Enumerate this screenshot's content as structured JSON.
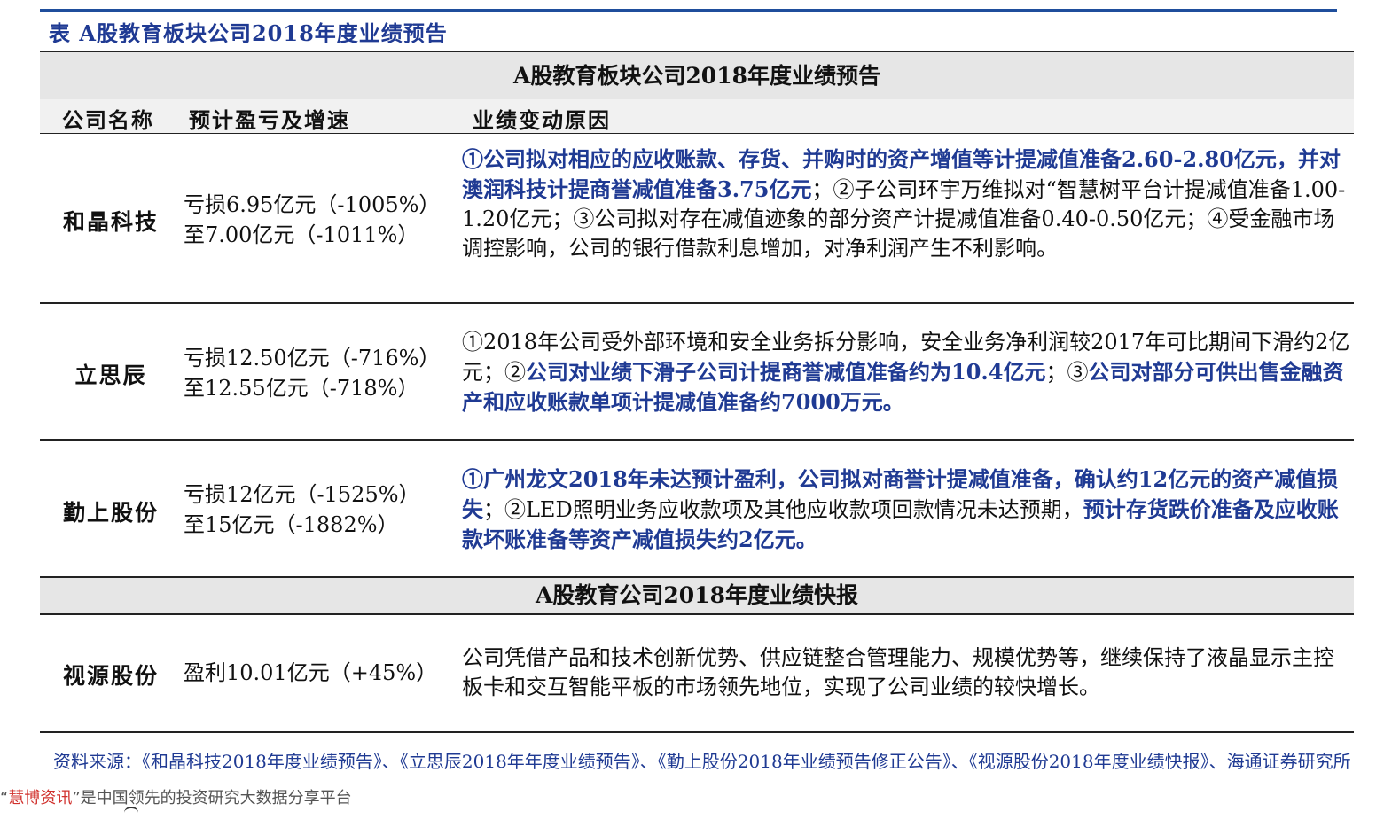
{
  "caption": "表 A股教育板块公司2018年度业绩预告",
  "section1_title": "A股教育板块公司2018年度业绩预告",
  "headers": {
    "company": "公司名称",
    "forecast": "预计盈亏及增速",
    "reason": "业绩变动原因"
  },
  "rows": [
    {
      "company": "和晶科技",
      "forecast_line1": "亏损6.95亿元（-1005%）",
      "forecast_line2": "至7.00亿元（-1011%）",
      "reason_parts": [
        {
          "text": "①公司拟对相应的应收账款、存货、并购时的资产增值等计提减值准备2.60-2.80亿元，并对澳润科技计提商誉减值准备3.75亿元",
          "highlight": true
        },
        {
          "text": "；②子公司环宇万维拟对“智慧树平台计提减值准备1.00-1.20亿元；③公司拟对存在减值迹象的部分资产计提减值准备0.40-0.50亿元；④受金融市场调控影响，公司的银行借款利息增加，对净利润产生不利影响。",
          "highlight": false
        }
      ]
    },
    {
      "company": "立思辰",
      "forecast_line1": "亏损12.50亿元（-716%）",
      "forecast_line2": "至12.55亿元（-718%）",
      "reason_parts": [
        {
          "text": "①2018年公司受外部环境和安全业务拆分影响，安全业务净利润较2017年可比期间下滑约2亿元；②",
          "highlight": false
        },
        {
          "text": "公司对业绩下滑子公司计提商誉减值准备约为10.4亿元",
          "highlight": true
        },
        {
          "text": "；③",
          "highlight": false
        },
        {
          "text": "公司对部分可供出售金融资产和应收账款单项计提减值准备约7000万元。",
          "highlight": true
        }
      ]
    },
    {
      "company": "勤上股份",
      "forecast_line1": "亏损12亿元（-1525%）",
      "forecast_line2": "至15亿元（-1882%）",
      "reason_parts": [
        {
          "text": "①广州龙文2018年未达预计盈利，公司拟对商誉计提减值准备，确认约12亿元的资产减值损失",
          "highlight": true
        },
        {
          "text": "；②LED照明业务应收款项及其他应收款项回款情况未达预期，",
          "highlight": false
        },
        {
          "text": "预计存货跌价准备及应收账款坏账准备等资产减值损失约2亿元。",
          "highlight": true
        }
      ]
    }
  ],
  "section2_title": "A股教育公司2018年度业绩快报",
  "express_rows": [
    {
      "company": "视源股份",
      "forecast_line1": "盈利10.01亿元（+45%）",
      "reason_parts": [
        {
          "text": "公司凭借产品和技术创新优势、供应链整合管理能力、规模优势等，继续保持了液晶显示主控板卡和交互智能平板的市场领先地位，实现了公司业绩的较快增长。",
          "highlight": false
        }
      ]
    }
  ],
  "source": "资料来源：《和晶科技2018年度业绩预告》、《立思辰2018年年度业绩预告》、《勤上股份2018年业绩预告修正公告》、《视源股份2018年度业绩快报》、海通证券研究所",
  "watermark": {
    "brand": "慧博资讯",
    "text": "是中国领先的投资研究大数据分享平台",
    "open_quote": "“",
    "close_quote": "”"
  },
  "colors": {
    "accent": "#1f3a93",
    "band": "#e6e6e6",
    "watermark_brand": "#d0302c"
  }
}
